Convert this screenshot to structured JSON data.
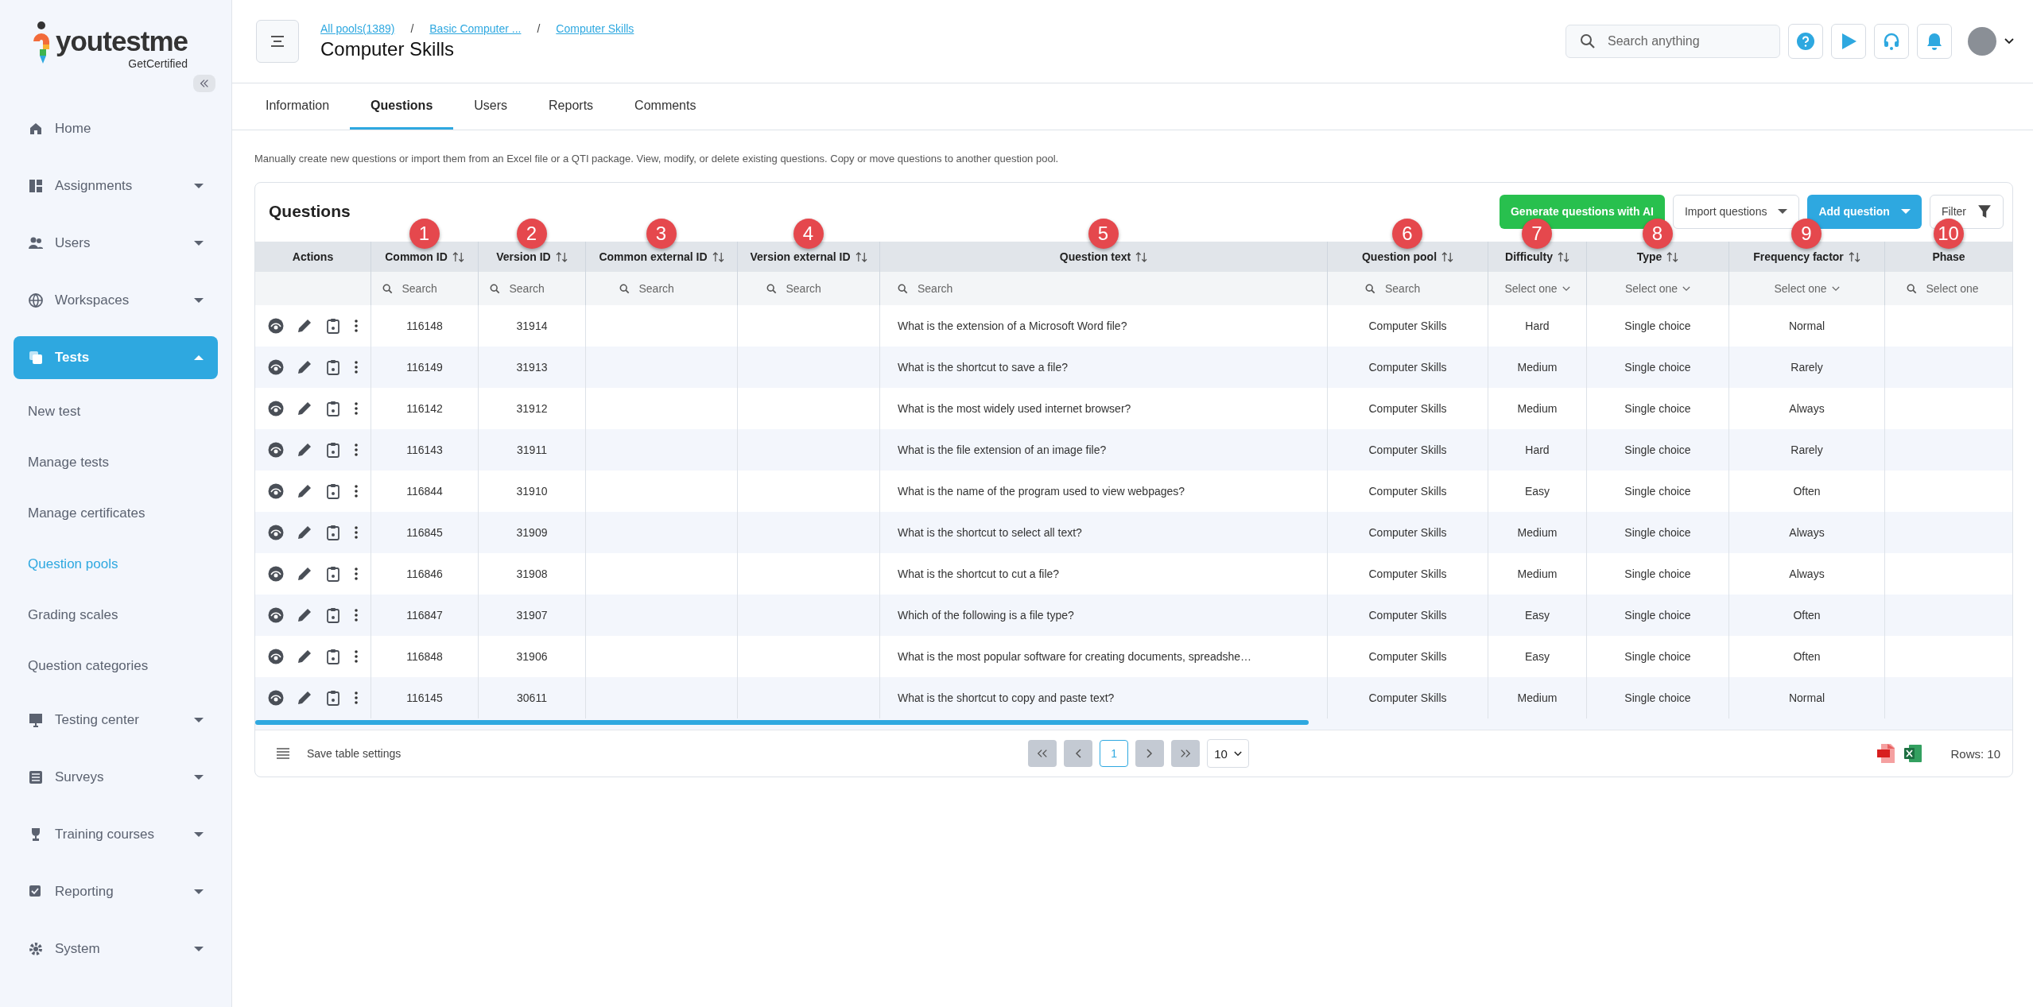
{
  "logo": {
    "name": "youtestme",
    "tagline": "GetCertified"
  },
  "sidebar": {
    "items": [
      {
        "label": "Home",
        "selected": false
      },
      {
        "label": "Assignments",
        "selected": false,
        "expanded": false
      },
      {
        "label": "Users",
        "selected": false,
        "expanded": false
      },
      {
        "label": "Workspaces",
        "selected": false,
        "expanded": false
      },
      {
        "label": "Tests",
        "selected": true,
        "expanded": true,
        "children": [
          {
            "label": "New test",
            "selected": false
          },
          {
            "label": "Manage tests",
            "selected": false
          },
          {
            "label": "Manage certificates",
            "selected": false
          },
          {
            "label": "Question pools",
            "selected": true
          },
          {
            "label": "Grading scales",
            "selected": false
          },
          {
            "label": "Question categories",
            "selected": false
          }
        ]
      },
      {
        "label": "Testing center",
        "selected": false,
        "expanded": false
      },
      {
        "label": "Surveys",
        "selected": false,
        "expanded": false
      },
      {
        "label": "Training courses",
        "selected": false,
        "expanded": false
      },
      {
        "label": "Reporting",
        "selected": false,
        "expanded": false
      },
      {
        "label": "System",
        "selected": false,
        "expanded": false
      }
    ]
  },
  "header": {
    "breadcrumbs": [
      "All pools(1389)",
      "Basic Computer ...",
      "Computer Skills"
    ],
    "separator": "/",
    "title": "Computer Skills",
    "search": {
      "placeholder": "Search anything"
    }
  },
  "tabs": [
    {
      "label": "Information",
      "selected": false
    },
    {
      "label": "Questions",
      "selected": true
    },
    {
      "label": "Users",
      "selected": false
    },
    {
      "label": "Reports",
      "selected": false
    },
    {
      "label": "Comments",
      "selected": false
    }
  ],
  "description": "Manually create new questions or import them from an Excel file or a QTI package. View, modify, or delete existing questions. Copy or move questions to another question pool.",
  "card": {
    "title": "Questions",
    "buttons": [
      {
        "label": "Generate questions with AI",
        "kind": "ai"
      },
      {
        "label": "Import questions",
        "kind": "dropdown"
      },
      {
        "label": "Add question",
        "kind": "primary"
      },
      {
        "label": "Filter",
        "kind": "filter"
      }
    ]
  },
  "table": {
    "columns": [
      {
        "label": "Actions",
        "sortable": false,
        "filter": {
          "kind": "none"
        }
      },
      {
        "label": "Common ID",
        "sortable": true,
        "marker": "1",
        "filter": {
          "kind": "search",
          "placeholder": "Search"
        }
      },
      {
        "label": "Version ID",
        "sortable": true,
        "marker": "2",
        "filter": {
          "kind": "search",
          "placeholder": "Search"
        }
      },
      {
        "label": "Common external ID",
        "sortable": true,
        "marker": "3",
        "filter": {
          "kind": "search",
          "placeholder": "Search"
        }
      },
      {
        "label": "Version external ID",
        "sortable": true,
        "marker": "4",
        "filter": {
          "kind": "search",
          "placeholder": "Search"
        }
      },
      {
        "label": "Question text",
        "sortable": true,
        "marker": "5",
        "filter": {
          "kind": "search",
          "placeholder": "Search"
        }
      },
      {
        "label": "Question pool",
        "sortable": true,
        "marker": "6",
        "filter": {
          "kind": "search",
          "placeholder": "Search"
        }
      },
      {
        "label": "Difficulty",
        "sortable": true,
        "marker": "7",
        "filter": {
          "kind": "select",
          "placeholder": "Select one"
        }
      },
      {
        "label": "Type",
        "sortable": true,
        "marker": "8",
        "filter": {
          "kind": "select",
          "placeholder": "Select one"
        }
      },
      {
        "label": "Frequency factor",
        "sortable": true,
        "marker": "9",
        "filter": {
          "kind": "select",
          "placeholder": "Select one"
        }
      },
      {
        "label": "Phase",
        "sortable": false,
        "marker": "10",
        "filter": {
          "kind": "search",
          "placeholder": "Select one"
        }
      }
    ],
    "rows": [
      {
        "common_id": "116148",
        "version_id": "31914",
        "question_text": "What is the extension of a Microsoft Word file?",
        "question_pool": "Computer Skills",
        "difficulty": "Hard",
        "type": "Single choice",
        "frequency_factor": "Normal"
      },
      {
        "common_id": "116149",
        "version_id": "31913",
        "question_text": "What is the shortcut to save a file?",
        "question_pool": "Computer Skills",
        "difficulty": "Medium",
        "type": "Single choice",
        "frequency_factor": "Rarely"
      },
      {
        "common_id": "116142",
        "version_id": "31912",
        "question_text": "What is the most widely used internet browser?",
        "question_pool": "Computer Skills",
        "difficulty": "Medium",
        "type": "Single choice",
        "frequency_factor": "Always"
      },
      {
        "common_id": "116143",
        "version_id": "31911",
        "question_text": "What is the file extension of an image file?",
        "question_pool": "Computer Skills",
        "difficulty": "Hard",
        "type": "Single choice",
        "frequency_factor": "Rarely"
      },
      {
        "common_id": "116844",
        "version_id": "31910",
        "question_text": "What is the name of the program used to view webpages?",
        "question_pool": "Computer Skills",
        "difficulty": "Easy",
        "type": "Single choice",
        "frequency_factor": "Often"
      },
      {
        "common_id": "116845",
        "version_id": "31909",
        "question_text": "What is the shortcut to select all text?",
        "question_pool": "Computer Skills",
        "difficulty": "Medium",
        "type": "Single choice",
        "frequency_factor": "Always"
      },
      {
        "common_id": "116846",
        "version_id": "31908",
        "question_text": "What is the shortcut to cut a file?",
        "question_pool": "Computer Skills",
        "difficulty": "Medium",
        "type": "Single choice",
        "frequency_factor": "Always"
      },
      {
        "common_id": "116847",
        "version_id": "31907",
        "question_text": "Which of the following is a file type?",
        "question_pool": "Computer Skills",
        "difficulty": "Easy",
        "type": "Single choice",
        "frequency_factor": "Often"
      },
      {
        "common_id": "116848",
        "version_id": "31906",
        "question_text": "What is the most popular software for creating documents, spreadshe…",
        "question_pool": "Computer Skills",
        "difficulty": "Easy",
        "type": "Single choice",
        "frequency_factor": "Often"
      },
      {
        "common_id": "116145",
        "version_id": "30611",
        "question_text": "What is the shortcut to copy and paste text?",
        "question_pool": "Computer Skills",
        "difficulty": "Medium",
        "type": "Single choice",
        "frequency_factor": "Normal"
      }
    ]
  },
  "footer": {
    "save_settings": "Save table settings",
    "current_page": "1",
    "page_size": "10",
    "rows": "Rows: 10"
  }
}
